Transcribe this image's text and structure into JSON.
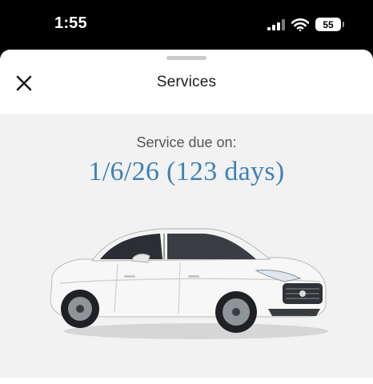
{
  "status_bar": {
    "time": "1:55",
    "battery": "55"
  },
  "nav": {
    "title": "Services",
    "close_icon": "close-icon"
  },
  "service": {
    "label": "Service due on:",
    "due": "1/6/26 (123 days)"
  },
  "colors": {
    "accent": "#3f82b6",
    "background": "#f2f2f2",
    "status_bar": "#000000"
  },
  "vehicle": {
    "image": "white sedan"
  }
}
